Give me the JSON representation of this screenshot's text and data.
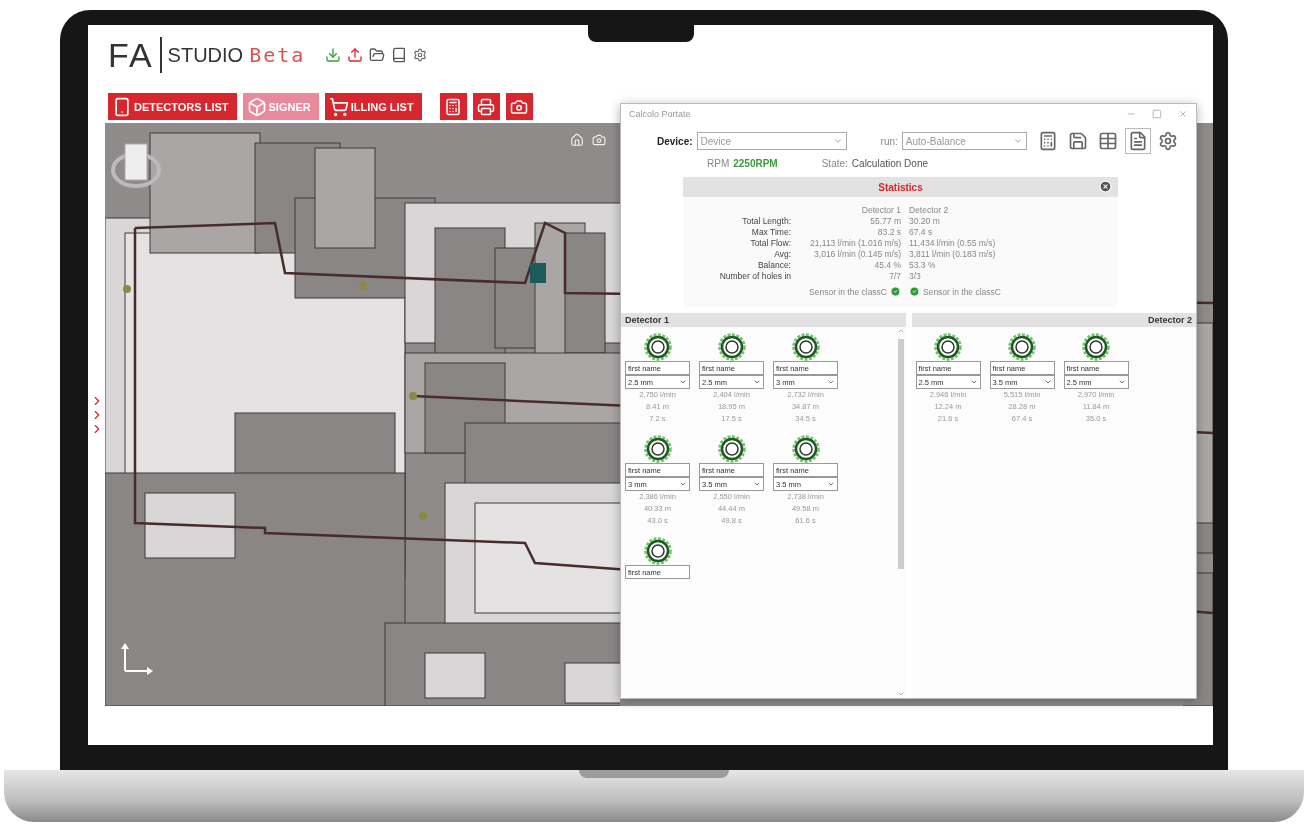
{
  "app": {
    "logo": "FA",
    "name": "STUDIO",
    "edition": "Beta"
  },
  "nav_buttons": [
    {
      "label": "DETECTORS LIST",
      "disabled": false
    },
    {
      "label": "SIGNER",
      "disabled": true
    },
    {
      "label": "ILLING LIST",
      "disabled": false
    }
  ],
  "dialog": {
    "title": "Calcolo Portate",
    "device_label": "Device:",
    "device": "Device",
    "run_label": "run:",
    "run": "Auto-Balance",
    "rpm_label": "RPM",
    "rpm": "2250RPM",
    "state_label": "State:",
    "state": "Calculation Done",
    "statistics": {
      "title": "Statistics",
      "columns": [
        "Detector 1",
        "Detector 2"
      ],
      "rows": [
        {
          "label": "Total Length:",
          "values": [
            "55.77 m",
            "30.20 m"
          ]
        },
        {
          "label": "Max Time:",
          "values": [
            "83.2 s",
            "67.4 s"
          ]
        },
        {
          "label": "Total Flow:",
          "values": [
            "21,113 l/min (1.016 m/s)",
            "11,434 l/min (0.55 m/s)"
          ]
        },
        {
          "label": "Avg:",
          "values": [
            "3,016 l/min (0.145 m/s)",
            "3,811 l/min (0.183 m/s)"
          ]
        },
        {
          "label": "Balance:",
          "values": [
            "45.4 %",
            "53.3 %"
          ]
        },
        {
          "label": "Number of holes in",
          "values": [
            "7/7",
            "3/3"
          ]
        }
      ],
      "checks": [
        {
          "text": "Sensor in the classC",
          "passed": true
        },
        {
          "text": "Sensor in the classC",
          "passed": true
        }
      ]
    },
    "detectors": [
      {
        "title": "Detector 1",
        "holes": [
          {
            "name": "first name",
            "size": "2.5 mm",
            "flow": "2,750 l/min",
            "length": "8.41 m",
            "time": "7.2 s"
          },
          {
            "name": "first name",
            "size": "2.5 mm",
            "flow": "2,404 l/min",
            "length": "18.95 m",
            "time": "17.5 s"
          },
          {
            "name": "first name",
            "size": "3 mm",
            "flow": "2,732 l/min",
            "length": "34.87 m",
            "time": "34.5 s"
          },
          {
            "name": "first name",
            "size": "3 mm",
            "flow": "2,386 l/min",
            "length": "40.33 m",
            "time": "43.0 s"
          },
          {
            "name": "first name",
            "size": "3.5 mm",
            "flow": "2,550 l/min",
            "length": "44.44 m",
            "time": "49.8 s"
          },
          {
            "name": "first name",
            "size": "3.5 mm",
            "flow": "2,738 l/min",
            "length": "49.58 m",
            "time": "61.6 s"
          },
          {
            "name": "first name"
          }
        ]
      },
      {
        "title": "Detector 2",
        "holes": [
          {
            "name": "first name",
            "size": "2.5 mm",
            "flow": "2,946 l/min",
            "length": "12.24 m",
            "time": "21.6 s"
          },
          {
            "name": "first name",
            "size": "3.5 mm",
            "flow": "5,515 l/min",
            "length": "28.28 m",
            "time": "67.4 s"
          },
          {
            "name": "first name",
            "size": "2.5 mm",
            "flow": "2,970 l/min",
            "length": "11.84 m",
            "time": "35.0 s"
          }
        ]
      }
    ]
  }
}
